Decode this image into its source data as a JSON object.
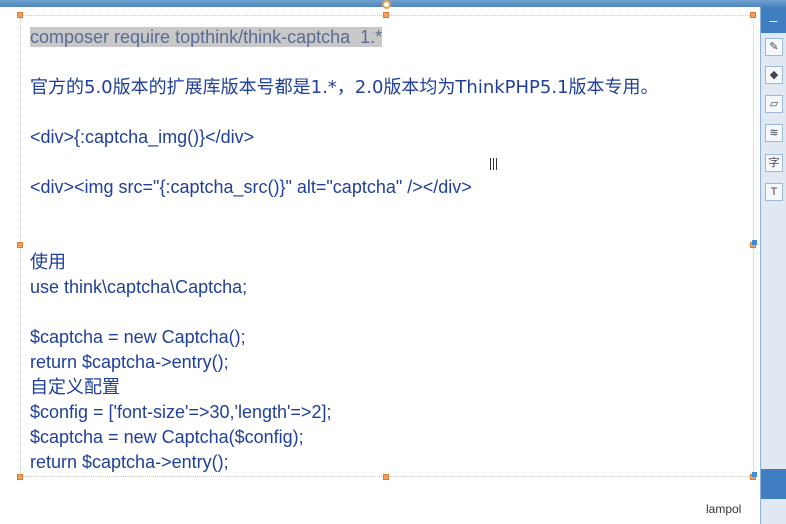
{
  "document": {
    "lines": [
      "composer require topthink/think-captcha  1.*",
      "",
      "官方的5.0版本的扩展库版本号都是1.*，2.0版本均为ThinkPHP5.1版本专用。",
      "",
      "<div>{:captcha_img()}</div>",
      "",
      "<div><img src=\"{:captcha_src()}\" alt=\"captcha\" /></div>",
      "",
      "",
      "使用",
      "use think\\captcha\\Captcha;",
      "",
      "$captcha = new Captcha();",
      "return $captcha->entry();",
      "自定义配置",
      "$config = ['font-size'=>30,'length'=>2];",
      "$captcha = new Captcha($config);",
      "return $captcha->entry();"
    ]
  },
  "footer": {
    "author": "lampol"
  },
  "sidebar": {
    "top_icon": "–",
    "tools": [
      {
        "icon": "edit-shape-icon",
        "glyph": "✎"
      },
      {
        "icon": "fill-color-icon",
        "glyph": "◆"
      },
      {
        "icon": "line-color-icon",
        "glyph": "▱"
      },
      {
        "icon": "layers-icon",
        "glyph": "≋"
      },
      {
        "icon": "text-style-icon",
        "glyph": "字"
      },
      {
        "icon": "text-box-icon",
        "glyph": "T"
      }
    ]
  },
  "colors": {
    "text": "#1f3f9a",
    "highlight": "#c8c8c8",
    "handle": "#f0a060",
    "accent": "#3f7ec0"
  }
}
